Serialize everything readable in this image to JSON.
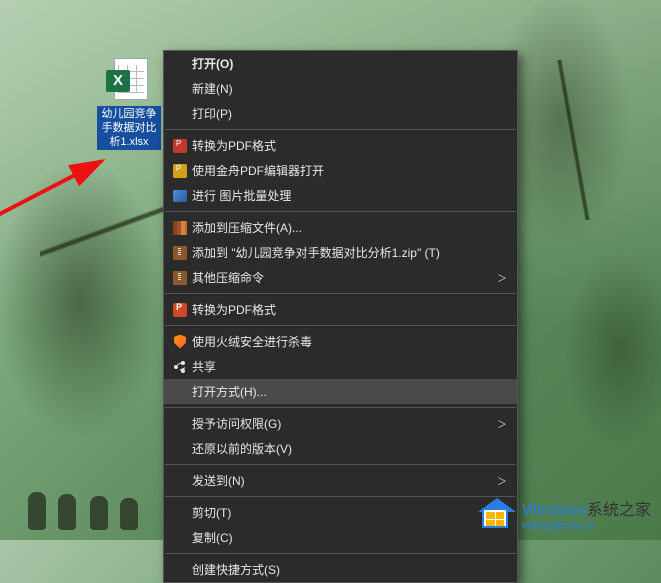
{
  "desktop": {
    "file_label": "幼儿园竞争手数据对比析1.xlsx",
    "excel_x": "X"
  },
  "menu": {
    "items": [
      {
        "label": "打开(O)",
        "icon": null,
        "submenu": false,
        "bold": true
      },
      {
        "label": "新建(N)",
        "icon": null,
        "submenu": false
      },
      {
        "label": "打印(P)",
        "icon": null,
        "submenu": false
      },
      {
        "sep": true
      },
      {
        "label": "转换为PDF格式",
        "icon": "pdf-red",
        "submenu": false
      },
      {
        "label": "使用金舟PDF编辑器打开",
        "icon": "pdf-gold",
        "submenu": false
      },
      {
        "label": "进行 图片批量处理",
        "icon": "img",
        "submenu": false
      },
      {
        "sep": true
      },
      {
        "label": "添加到压缩文件(A)...",
        "icon": "books",
        "submenu": false
      },
      {
        "label": "添加到 \"幼儿园竞争对手数据对比分析1.zip\" (T)",
        "icon": "zip",
        "submenu": false
      },
      {
        "label": "其他压缩命令",
        "icon": "zip",
        "submenu": true
      },
      {
        "sep": true
      },
      {
        "label": "转换为PDF格式",
        "icon": "ppt",
        "submenu": false
      },
      {
        "sep": true
      },
      {
        "label": "使用火绒安全进行杀毒",
        "icon": "shield",
        "submenu": false
      },
      {
        "label": "共享",
        "icon": "share",
        "submenu": false
      },
      {
        "label": "打开方式(H)...",
        "icon": null,
        "submenu": false,
        "highlight": true
      },
      {
        "sep": true
      },
      {
        "label": "授予访问权限(G)",
        "icon": null,
        "submenu": true
      },
      {
        "label": "还原以前的版本(V)",
        "icon": null,
        "submenu": false
      },
      {
        "sep": true
      },
      {
        "label": "发送到(N)",
        "icon": null,
        "submenu": true
      },
      {
        "sep": true
      },
      {
        "label": "剪切(T)",
        "icon": null,
        "submenu": false
      },
      {
        "label": "复制(C)",
        "icon": null,
        "submenu": false
      },
      {
        "sep": true
      },
      {
        "label": "创建快捷方式(S)",
        "icon": null,
        "submenu": false
      }
    ]
  },
  "branding": {
    "line1_a": "Windows",
    "line1_b": "系统之家",
    "line2": "www.bjkmw.cn"
  }
}
